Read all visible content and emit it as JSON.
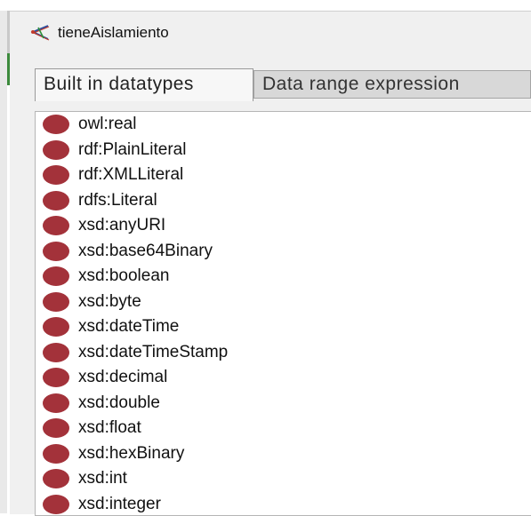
{
  "window": {
    "title": "tieneAislamiento",
    "title_icon": "object-property-icon"
  },
  "tabs": [
    {
      "label": "Built in datatypes",
      "active": true
    },
    {
      "label": "Data range expression",
      "active": false
    }
  ],
  "datatypes": [
    "owl:real",
    "rdf:PlainLiteral",
    "rdf:XMLLiteral",
    "rdfs:Literal",
    "xsd:anyURI",
    "xsd:base64Binary",
    "xsd:boolean",
    "xsd:byte",
    "xsd:dateTime",
    "xsd:dateTimeStamp",
    "xsd:decimal",
    "xsd:double",
    "xsd:float",
    "xsd:hexBinary",
    "xsd:int",
    "xsd:integer"
  ],
  "colors": {
    "datatype_dot": "#a3323a",
    "window_bg": "#f0f0f0"
  }
}
